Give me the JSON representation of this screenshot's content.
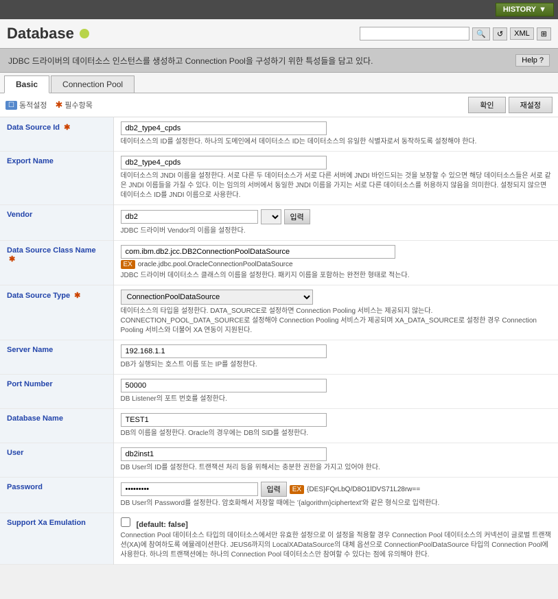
{
  "topbar": {
    "history_label": "HISTORY"
  },
  "header": {
    "title": "Database",
    "search_placeholder": ""
  },
  "infobar": {
    "text": "JDBC 드라이버의 데이터소스 인스턴스를 생성하고 Connection Pool을 구성하기 위한 특성들을 담고 있다.",
    "help_label": "Help",
    "help_icon": "?"
  },
  "tabs": [
    {
      "id": "basic",
      "label": "Basic",
      "active": true
    },
    {
      "id": "connection-pool",
      "label": "Connection Pool",
      "active": false
    }
  ],
  "toolbar": {
    "dynamic_label": "동적설정",
    "required_label": "필수항목",
    "confirm_label": "확인",
    "reset_label": "재설정"
  },
  "fields": [
    {
      "id": "data-source-id",
      "label": "Data Source Id",
      "required": true,
      "value": "db2_type4_cpds",
      "desc": "데이터소스의 ID를 설정한다. 하나의 도메인에서 데이터소스 ID는 데이터소스의 유일한 식별자로서 동작하도록 설정해야 한다."
    },
    {
      "id": "export-name",
      "label": "Export Name",
      "required": false,
      "value": "db2_type4_cpds",
      "desc": "데이터소스의 JNDI 이름을 설정한다. 서로 다른 두 데이터소스가 서로 다른 서버에 JNDI 바인드되는 것을 보장할 수 있으면 해당 데이터소스들은 서로 같은 JNDI 이름들을 가질 수 있다. 이는 임의의 서버에서 동일한 JNDI 이름을 가지는 서로 다른 데이터소스를 허용하지 않음을 의미한다. 설정되지 않으면 데이터소스 ID를 JNDI 이름으로 사용한다."
    },
    {
      "id": "vendor",
      "label": "Vendor",
      "required": false,
      "value": "db2",
      "desc": "JDBC 드라이버 Vendor의 이름을 설정한다.",
      "has_select": true,
      "has_input_btn": true
    },
    {
      "id": "data-source-class-name",
      "label": "Data Source Class Name",
      "required": true,
      "value": "com.ibm.db2.jcc.DB2ConnectionPoolDataSource",
      "suggestion": "oracle.jdbc.pool.OracleConnectionPoolDataSource",
      "desc": "JDBC 드라이버 데이터소스 클래스의 이름을 설정한다. 패키지 이름을 포함하는 완전한 형태로 적는다."
    },
    {
      "id": "data-source-type",
      "label": "Data Source Type",
      "required": true,
      "value": "ConnectionPoolDataSource",
      "desc": "데이터소스의 타입을 설정한다. DATA_SOURCE로 설정하면 Connection Pooling 서비스는 제공되지 않는다. CONNECTION_POOL_DATA_SOURCE로 설정해야 Connection Pooling 서비스가 제공되며 XA_DATA_SOURCE로 설정한 경우 Connection Pooling 서비스와 더불어 XA 연동이 지원된다."
    },
    {
      "id": "server-name",
      "label": "Server Name",
      "required": false,
      "value": "192.168.1.1",
      "desc": "DB가 실행되는 호스트 이름 또는 IP를 설정한다."
    },
    {
      "id": "port-number",
      "label": "Port Number",
      "required": false,
      "value": "50000",
      "desc": "DB Listener의 포트 번호를 설정한다."
    },
    {
      "id": "database-name",
      "label": "Database Name",
      "required": false,
      "value": "TEST1",
      "desc": "DB의 이름을 설정한다. Oracle의 경우에는 DB의 SID를 설정한다."
    },
    {
      "id": "user",
      "label": "User",
      "required": false,
      "value": "db2inst1",
      "desc": "DB User의 ID를 설정한다. 트랜잭션 처리 등을 위해서는 충분한 권한을 가지고 있어야 한다."
    },
    {
      "id": "password",
      "label": "Password",
      "required": false,
      "value": "••••••••|",
      "enc_badge": "EX",
      "enc_value": "{DES}FQrLbQ/D8O1lDVS71L28rw==",
      "desc": "DB User의 Password를 설정한다. 암호화해서 저장할 때에는 '{algorithm}ciphertext'와 같은 형식으로 입력한다.",
      "has_input_btn": true
    },
    {
      "id": "support-xa-emulation",
      "label": "Support Xa Emulation",
      "required": false,
      "is_checkbox": true,
      "default_text": "[default: false]",
      "desc": "Connection Pool 데이터소스 타입의 데이터소스에서만 유효한 설정으로 이 설정을 적용할 경우 Connection Pool 데이터소스의 커넥션이 글로벌 트랜잭션(XA)에 참여하도록 에뮬레이션한다. JEUS6까지의 LocalXADataSource의 대체 옵션으로 ConnectionPoolDataSource 타입의 Connection Pool에 사용한다. 하나의 트랜잭션에는 하나의 Connection Pool 데이터소스만 참여할 수 있다는 점에 유의해야 한다."
    }
  ]
}
